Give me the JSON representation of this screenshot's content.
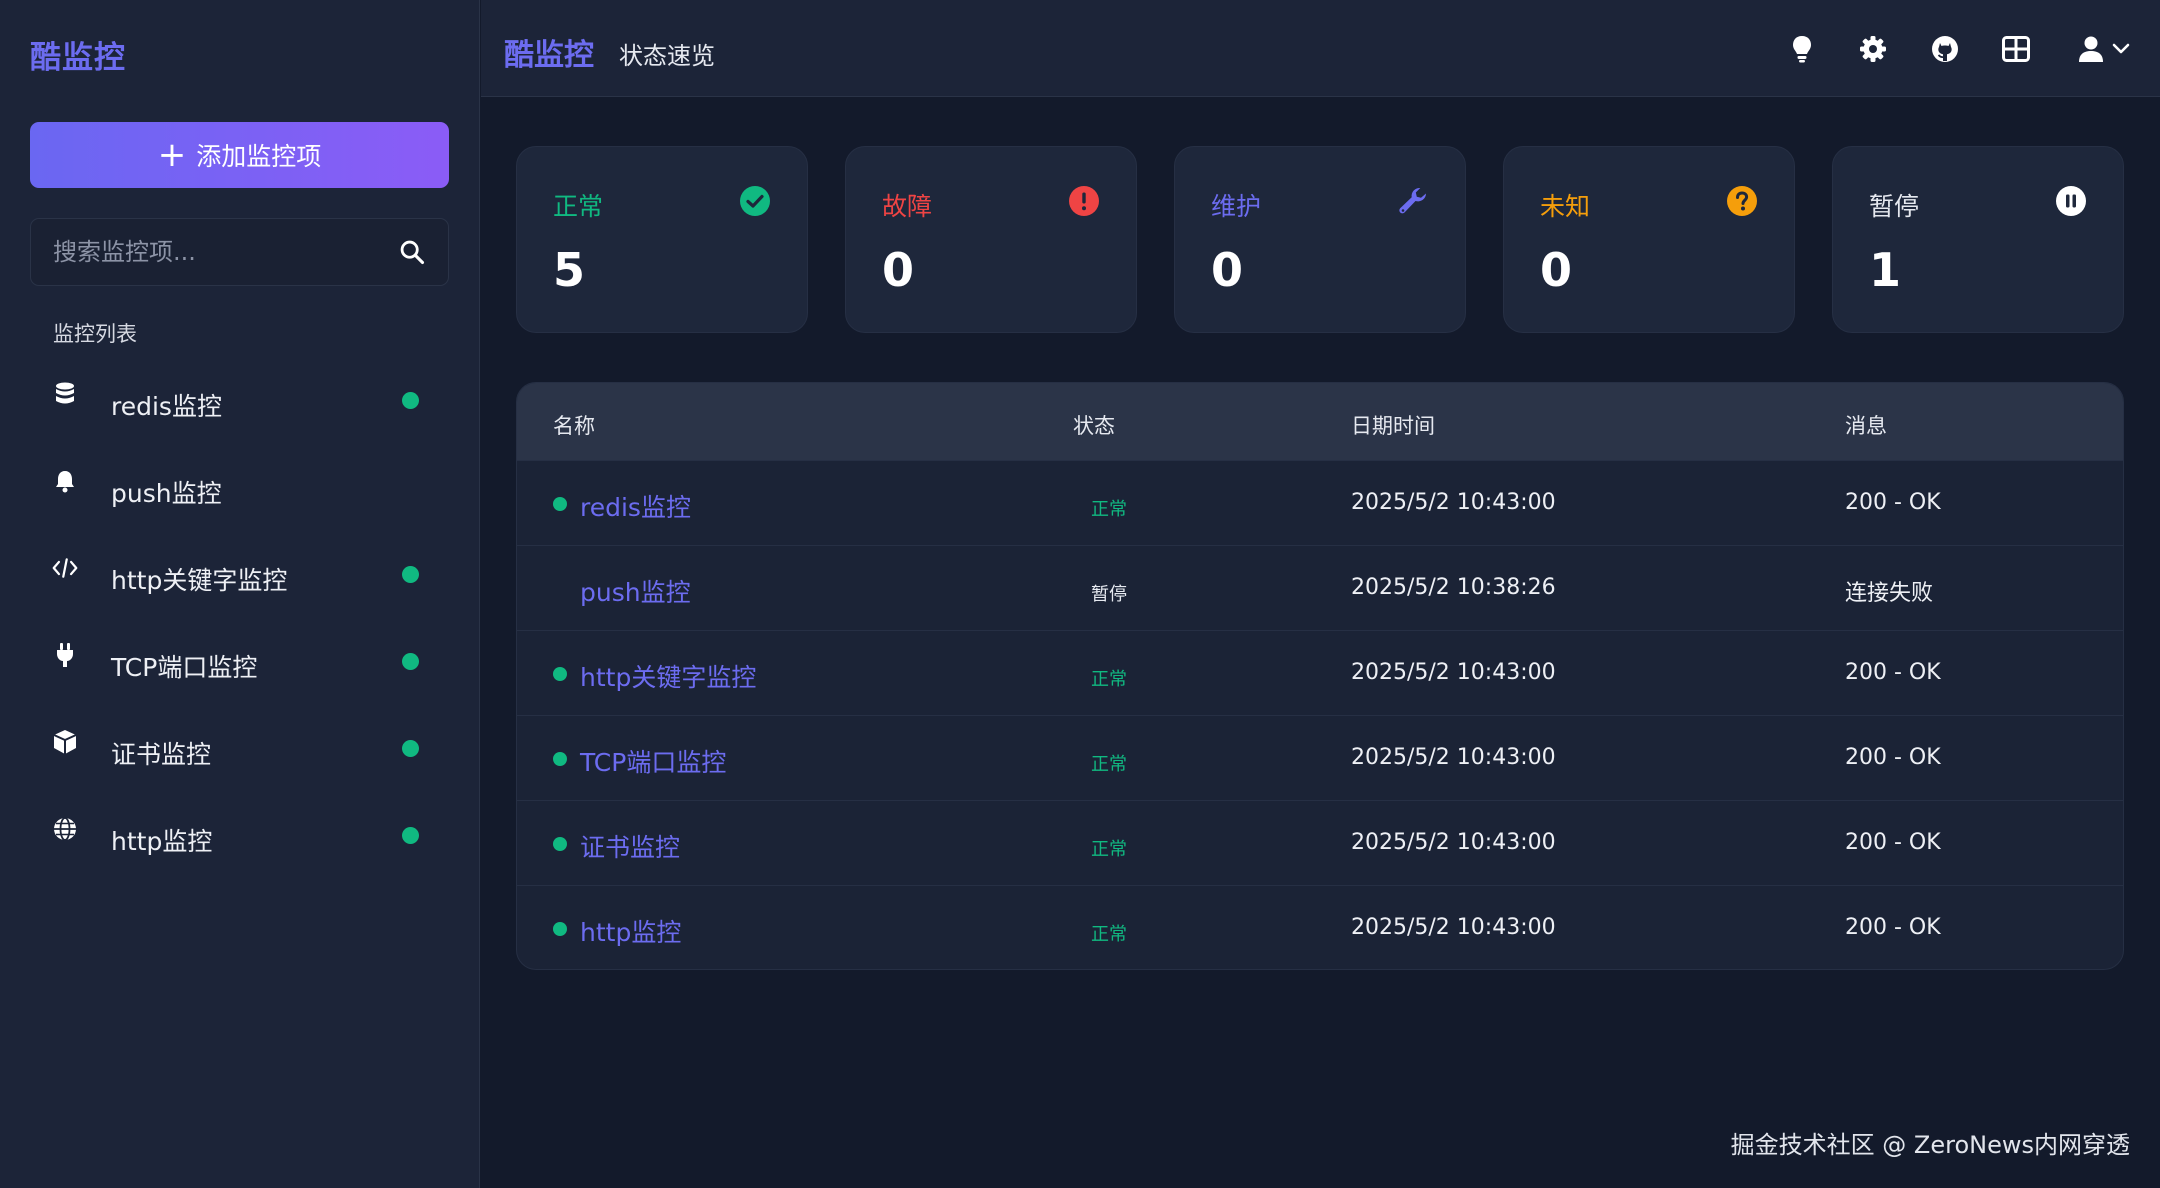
{
  "sidebar": {
    "brand": "酷监控",
    "add_button_label": "添加监控项",
    "search_placeholder": "搜索监控项...",
    "list_heading": "监控列表",
    "items": [
      {
        "label": "redis监控",
        "icon": "database-icon",
        "active": true
      },
      {
        "label": "push监控",
        "icon": "bell-icon",
        "active": false
      },
      {
        "label": "http关键字监控",
        "icon": "code-icon",
        "active": true
      },
      {
        "label": "TCP端口监控",
        "icon": "plug-icon",
        "active": true
      },
      {
        "label": "证书监控",
        "icon": "cube-icon",
        "active": true
      },
      {
        "label": "http监控",
        "icon": "globe-icon",
        "active": true
      }
    ]
  },
  "header": {
    "brand": "酷监控",
    "subtitle": "状态速览",
    "icons": [
      "lightbulb-icon",
      "gear-icon",
      "github-icon",
      "grid-icon",
      "user-icon",
      "chevron-down-icon"
    ]
  },
  "stats": [
    {
      "title": "正常",
      "value": "5",
      "color": "#10b981",
      "icon": "check-circle-icon"
    },
    {
      "title": "故障",
      "value": "0",
      "color": "#ef4444",
      "icon": "alert-circle-icon"
    },
    {
      "title": "维护",
      "value": "0",
      "color": "#6c6cf0",
      "icon": "wrench-icon"
    },
    {
      "title": "未知",
      "value": "0",
      "color": "#f59e0b",
      "icon": "question-circle-icon"
    },
    {
      "title": "暂停",
      "value": "1",
      "color": "#e6e9f0",
      "icon": "pause-circle-icon"
    }
  ],
  "table": {
    "headers": {
      "name": "名称",
      "status": "状态",
      "datetime": "日期时间",
      "message": "消息"
    },
    "rows": [
      {
        "name": "redis监控",
        "status": "正常",
        "datetime": "2025/5/2 10:43:00",
        "message": "200 - OK",
        "active": true
      },
      {
        "name": "push监控",
        "status": "暂停",
        "datetime": "2025/5/2 10:38:26",
        "message": "连接失败",
        "active": false
      },
      {
        "name": "http关键字监控",
        "status": "正常",
        "datetime": "2025/5/2 10:43:00",
        "message": "200 - OK",
        "active": true
      },
      {
        "name": "TCP端口监控",
        "status": "正常",
        "datetime": "2025/5/2 10:43:00",
        "message": "200 - OK",
        "active": true
      },
      {
        "name": "证书监控",
        "status": "正常",
        "datetime": "2025/5/2 10:43:00",
        "message": "200 - OK",
        "active": true
      },
      {
        "name": "http监控",
        "status": "正常",
        "datetime": "2025/5/2 10:43:00",
        "message": "200 - OK",
        "active": true
      }
    ]
  },
  "colors": {
    "accent": "#6c6cf0",
    "ok": "#10b981",
    "paused": "#e6e9f0"
  },
  "watermark": "掘金技术社区 @ ZeroNews内网穿透"
}
